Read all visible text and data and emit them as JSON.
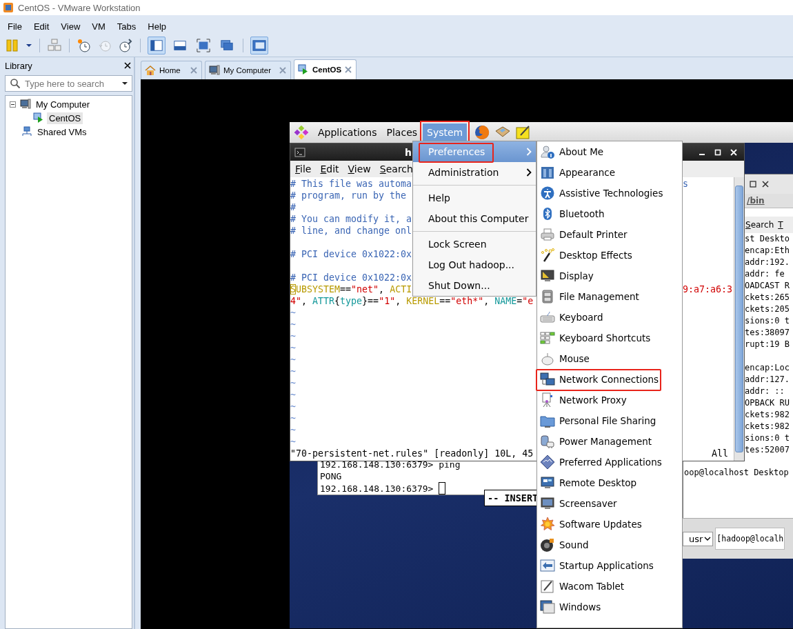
{
  "window": {
    "title": "CentOS - VMware Workstation"
  },
  "menubar": [
    "File",
    "Edit",
    "View",
    "VM",
    "Tabs",
    "Help"
  ],
  "toolbar": {
    "view_buttons": [
      {
        "selected": true
      },
      {
        "selected": false
      },
      {
        "selected": false
      },
      {
        "selected": false
      },
      {
        "selected": true
      }
    ]
  },
  "library": {
    "title": "Library",
    "search": {
      "placeholder": "Type here to search"
    },
    "tree": [
      {
        "label": "My Computer",
        "expanded": true,
        "selected": false,
        "children": [
          {
            "label": "CentOS",
            "selected": true
          }
        ]
      },
      {
        "label": "Shared VMs",
        "selected": false
      }
    ]
  },
  "tabs": [
    {
      "label": "Home",
      "selected": false
    },
    {
      "label": "My Computer",
      "selected": false
    },
    {
      "label": "CentOS",
      "selected": true
    }
  ],
  "guest": {
    "panel": {
      "items": [
        {
          "label": "Applications",
          "selected": false,
          "annotated": false
        },
        {
          "label": "Places",
          "selected": false,
          "annotated": false
        },
        {
          "label": "System",
          "selected": true,
          "annotated": true
        }
      ]
    },
    "system_menu": {
      "sections": [
        {
          "items": [
            {
              "label": "Preferences",
              "submenu": true,
              "selected": true,
              "annotated": true
            },
            {
              "label": "Administration",
              "submenu": true,
              "selected": false,
              "annotated": false
            }
          ]
        },
        {
          "items": [
            {
              "label": "Help",
              "submenu": false,
              "selected": false,
              "annotated": false
            },
            {
              "label": "About this Computer",
              "submenu": false,
              "selected": false,
              "annotated": false
            }
          ]
        },
        {
          "items": [
            {
              "label": "Lock Screen",
              "submenu": false,
              "selected": false,
              "annotated": false
            },
            {
              "label": "Log Out hadoop...",
              "submenu": false,
              "selected": false,
              "annotated": false
            },
            {
              "label": "Shut Down...",
              "submenu": false,
              "selected": false,
              "annotated": false
            }
          ]
        }
      ]
    },
    "preferences_menu": {
      "items": [
        {
          "label": "About Me",
          "annotated": false
        },
        {
          "label": "Appearance",
          "annotated": false
        },
        {
          "label": "Assistive Technologies",
          "annotated": false
        },
        {
          "label": "Bluetooth",
          "annotated": false
        },
        {
          "label": "Default Printer",
          "annotated": false
        },
        {
          "label": "Desktop Effects",
          "annotated": false
        },
        {
          "label": "Display",
          "annotated": false
        },
        {
          "label": "File Management",
          "annotated": false
        },
        {
          "label": "Keyboard",
          "annotated": false
        },
        {
          "label": "Keyboard Shortcuts",
          "annotated": false
        },
        {
          "label": "Mouse",
          "annotated": false
        },
        {
          "label": "Network Connections",
          "annotated": true
        },
        {
          "label": "Network Proxy",
          "annotated": false
        },
        {
          "label": "Personal File Sharing",
          "annotated": false
        },
        {
          "label": "Power Management",
          "annotated": false
        },
        {
          "label": "Preferred Applications",
          "annotated": false
        },
        {
          "label": "Remote Desktop",
          "annotated": false
        },
        {
          "label": "Screensaver",
          "annotated": false
        },
        {
          "label": "Software Updates",
          "annotated": false
        },
        {
          "label": "Sound",
          "annotated": false
        },
        {
          "label": "Startup Applications",
          "annotated": false
        },
        {
          "label": "Wacom Tablet",
          "annotated": false
        },
        {
          "label": "Windows",
          "annotated": false
        }
      ]
    },
    "vim_window": {
      "title": "h",
      "menu": [
        "File",
        "Edit",
        "View",
        "Search"
      ],
      "lines": [
        {
          "kind": "text",
          "segments": [
            {
              "kind": "comment",
              "text": "# This file was automa"
            }
          ],
          "right": [
            {
              "kind": "comment",
              "text": "s"
            }
          ]
        },
        {
          "kind": "text",
          "segments": [
            {
              "kind": "comment",
              "text": "# program, run by the"
            }
          ]
        },
        {
          "kind": "text",
          "segments": [
            {
              "kind": "comment",
              "text": "#"
            }
          ]
        },
        {
          "kind": "text",
          "segments": [
            {
              "kind": "comment",
              "text": "# You can modify it, a"
            }
          ]
        },
        {
          "kind": "text",
          "segments": [
            {
              "kind": "comment",
              "text": "# line, and change onl"
            }
          ]
        },
        {
          "kind": "blank"
        },
        {
          "kind": "text",
          "segments": [
            {
              "kind": "comment",
              "text": "# PCI device 0x1022:0x"
            }
          ]
        },
        {
          "kind": "blank"
        },
        {
          "kind": "text",
          "segments": [
            {
              "kind": "comment",
              "text": "# PCI device 0x1022:0x"
            }
          ]
        },
        {
          "kind": "text",
          "segments": [
            {
              "kind": "cursor",
              "text": "S"
            },
            {
              "kind": "ident",
              "text": "UBSYSTEM"
            },
            {
              "kind": "op",
              "text": "=="
            },
            {
              "kind": "string",
              "text": "\"net\""
            },
            {
              "kind": "op",
              "text": ", "
            },
            {
              "kind": "ident",
              "text": "ACTI"
            }
          ],
          "right": [
            {
              "kind": "string",
              "text": "9:a7:a6:3"
            }
          ]
        },
        {
          "kind": "text",
          "segments": [
            {
              "kind": "string",
              "text": "4\""
            },
            {
              "kind": "op",
              "text": ", "
            },
            {
              "kind": "attr",
              "text": "ATTR"
            },
            {
              "kind": "op",
              "text": "{"
            },
            {
              "kind": "attr",
              "text": "type"
            },
            {
              "kind": "op",
              "text": "}=="
            },
            {
              "kind": "string",
              "text": "\"1\""
            },
            {
              "kind": "op",
              "text": ", "
            },
            {
              "kind": "ident",
              "text": "KERNEL"
            },
            {
              "kind": "op",
              "text": "=="
            },
            {
              "kind": "string",
              "text": "\"eth*\""
            },
            {
              "kind": "op",
              "text": ", "
            },
            {
              "kind": "attr",
              "text": "NAME"
            },
            {
              "kind": "op",
              "text": "="
            },
            {
              "kind": "string",
              "text": "\"e"
            }
          ]
        },
        {
          "kind": "tilde",
          "text": "~"
        },
        {
          "kind": "tilde",
          "text": "~"
        },
        {
          "kind": "tilde",
          "text": "~"
        },
        {
          "kind": "tilde",
          "text": "~"
        },
        {
          "kind": "tilde",
          "text": "~"
        },
        {
          "kind": "tilde",
          "text": "~"
        },
        {
          "kind": "tilde",
          "text": "~"
        },
        {
          "kind": "tilde",
          "text": "~"
        },
        {
          "kind": "tilde",
          "text": "~"
        },
        {
          "kind": "tilde",
          "text": "~"
        },
        {
          "kind": "tilde",
          "text": "~"
        },
        {
          "kind": "tilde",
          "text": "~"
        }
      ],
      "status": {
        "text": "\"70-persistent-net.rules\" [readonly] 10L, 45",
        "position": "All"
      }
    },
    "redis_terminal": {
      "lines": [
        "192.168.148.130:6379> ping",
        "PONG"
      ],
      "prompt": "192.168.148.130:6379>"
    },
    "insert_window": {
      "text": "-- INSERT"
    },
    "back_terminal": {
      "tab": "/bin",
      "menu": [
        "Search",
        "T"
      ],
      "blocks": [
        {
          "lines": [
            "st Deskto",
            "encap:Eth",
            "addr:192.",
            "addr: fe",
            "OADCAST R",
            "ckets:265",
            "ckets:205",
            "sions:0 t",
            "tes:38097",
            "rupt:19 B"
          ]
        },
        {
          "lines": [
            "encap:Loc",
            "addr:127.",
            "addr: ::",
            "OPBACK RU",
            "ckets:982",
            "ckets:982",
            "sions:0 t",
            "tes:52007"
          ]
        }
      ],
      "bottom_line": "oop@localhost Desktop"
    },
    "bottom_bar": {
      "dropdown": "usr",
      "text": "[hadoop@localh"
    }
  }
}
